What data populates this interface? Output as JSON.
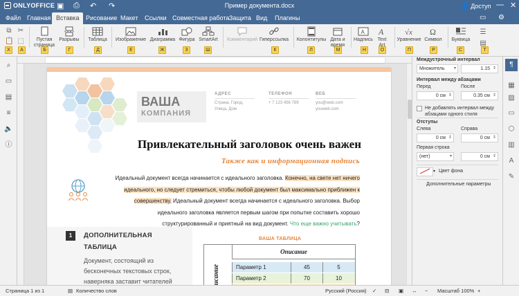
{
  "app": {
    "name": "ONLYOFFICE",
    "doc_title": "Пример документа.docx",
    "account_label": "Доступ"
  },
  "menu": {
    "tabs": [
      "Файл",
      "Главная",
      "Вставка",
      "Рисование",
      "Макет",
      "Ссылки",
      "Совместная работа",
      "Защита",
      "Вид",
      "Плагины"
    ],
    "active": "Вставка"
  },
  "toolbar": {
    "blank_page": "Пустая страница",
    "breaks": "Разрывы",
    "table": "Таблица",
    "image": "Изображение",
    "chart": "Диаграмма",
    "shape": "Фигура",
    "smartart": "SmartArt",
    "comment": "Комментарий",
    "hyperlink": "Гиперссылка",
    "header_footer": "Колонтитулы",
    "datetime": "Дата и время",
    "textbox": "Надпись",
    "textart": "Text Art",
    "equation": "Уравнение",
    "symbol": "Символ",
    "dropcap": "Буквица",
    "hints": [
      "Х",
      "А",
      "Б",
      "Г",
      "Д",
      "Е",
      "Ж",
      "З",
      "Ш",
      "К",
      "Л",
      "М",
      "Н",
      "О",
      "П",
      "Р",
      "С",
      "Т"
    ]
  },
  "document": {
    "brand_name": "ВАША",
    "brand_sub": "КОМПАНИЯ",
    "address_h": "АДРЕС",
    "address_v": "Страна, Город,",
    "address_v2": "Улица, Дом",
    "phone_h": "ТЕЛЕФОН",
    "phone_v": "+ 7 123 456 789",
    "web_h": "ВЕБ",
    "web_v": "you@web.com",
    "web_v2": "youweb.com",
    "headline": "Привлекательный заголовок очень важен",
    "subhead": "Также как и информационная подпись",
    "para": {
      "p1a": "Идеальный документ всегда начинается с идеального заголовка. ",
      "p1b": "Конечно, на свете нет ничего идеального, но следует стремиться, чтобы любой документ был максимально приближен к совершенству.",
      "p1c": " Идеальный документ всегда начинается с идеального заголовка. Выбор идеального заголовка является первым шагом при попытке составить хорошо структурированный и приятный на вид документ. ",
      "p1d": "Что еще важно учитывать",
      "p1e": "?"
    },
    "section_num": "1",
    "section_title": "ДОПОЛНИТЕЛЬНАЯ ТАБЛИЦА",
    "section_body": "Документ, состоящий из бесконечных текстовых строк, наверняка заставит читателей",
    "table_title": "ВАША ТАБЛИЦА",
    "table_header": "Описание",
    "table_vlabel": "Описание",
    "table_rows": [
      {
        "name": "Параметр 1",
        "a": "45",
        "b": "5"
      },
      {
        "name": "Параметр 2",
        "a": "70",
        "b": "10"
      }
    ]
  },
  "panel": {
    "line_spacing": "Междустрочный интервал",
    "line_mode": "Множитель",
    "line_value": "1.15",
    "para_spacing": "Интервал между абзацами",
    "before": "Перед",
    "after": "После",
    "before_val": "0 см",
    "after_val": "0.35 см",
    "no_interval": "Не добавлять интервал между абзацами одного стиля",
    "indents": "Отступы",
    "left": "Слева",
    "right": "Справа",
    "left_val": "0 см",
    "right_val": "0 см",
    "first_line": "Первая строка",
    "first_mode": "(нет)",
    "first_val": "0 см",
    "bg_color": "Цвет фона",
    "advanced": "Дополнительные параметры"
  },
  "status": {
    "page": "Страница 1 из 1",
    "words": "Количество слов",
    "lang": "Русский (Россия)",
    "zoom": "Масштаб 100%"
  },
  "colors": {
    "accent": "#446995",
    "orange": "#e8863a",
    "green": "#3aa36c",
    "highlight": "#fbe3c4"
  }
}
